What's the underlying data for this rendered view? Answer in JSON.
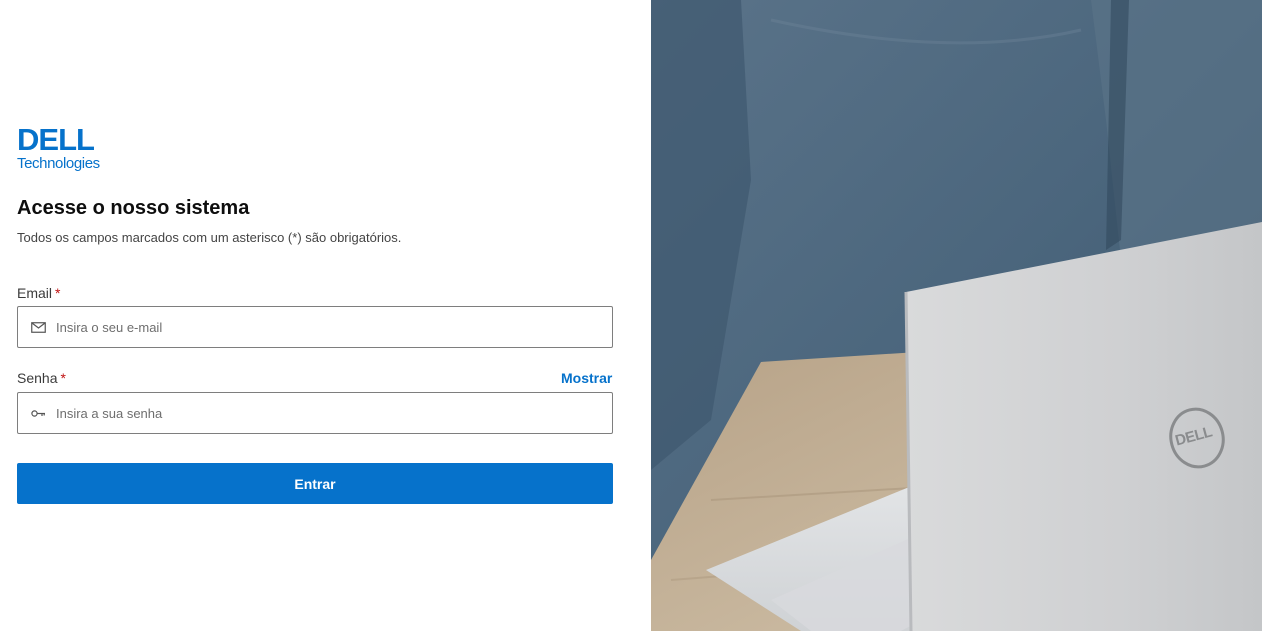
{
  "brand": {
    "logo_word": "DELL",
    "logo_sub": "Technologies",
    "color": "#0672cb"
  },
  "form": {
    "title": "Acesse o nosso sistema",
    "subtitle": "Todos os campos marcados com um asterisco (*) são obrigatórios.",
    "email": {
      "label": "Email",
      "required_mark": "*",
      "placeholder": "Insira o seu e-mail",
      "value": "",
      "icon": "envelope-icon"
    },
    "password": {
      "label": "Senha",
      "required_mark": "*",
      "placeholder": "Insira a sua senha",
      "value": "",
      "icon": "key-icon",
      "show_label": "Mostrar"
    },
    "submit_label": "Entrar"
  },
  "hero_image": {
    "subject": "laptop-on-desk",
    "laptop_logo": "DELL"
  }
}
